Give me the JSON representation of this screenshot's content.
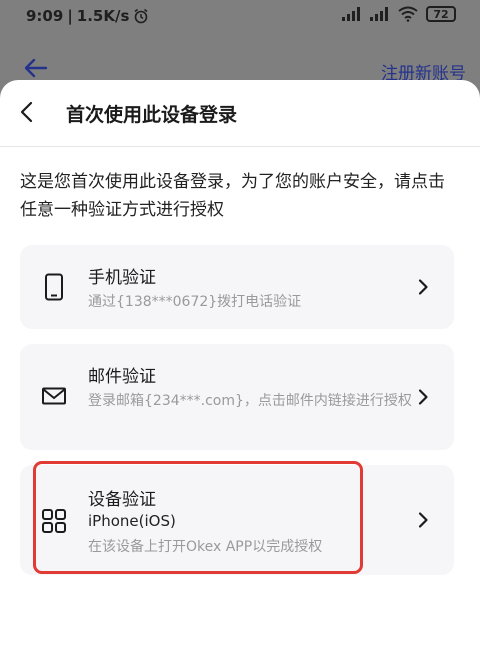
{
  "status_bar": {
    "time": "9:09",
    "speed": "1.5K/s",
    "battery": "72"
  },
  "background": {
    "register_label": "注册新账号"
  },
  "sheet": {
    "title": "首次使用此设备登录",
    "intro": "这是您首次使用此设备登录，为了您的账户安全，请点击任意一种验证方式进行授权",
    "options": [
      {
        "icon": "phone-icon",
        "title": "手机验证",
        "description": "通过{138***0672}拨打电话验证"
      },
      {
        "icon": "mail-icon",
        "title": "邮件验证",
        "description": "登录邮箱{234***.com}，点击邮件内链接进行授权"
      },
      {
        "icon": "grid-icon",
        "title": "设备验证",
        "subtitle": "iPhone(iOS)",
        "description": "在该设备上打开Okex APP以完成授权"
      }
    ]
  },
  "colors": {
    "overlay": "#7f7f7f",
    "highlight": "#e03b34",
    "card_bg": "#f6f6f8",
    "register_link": "#24328c"
  }
}
